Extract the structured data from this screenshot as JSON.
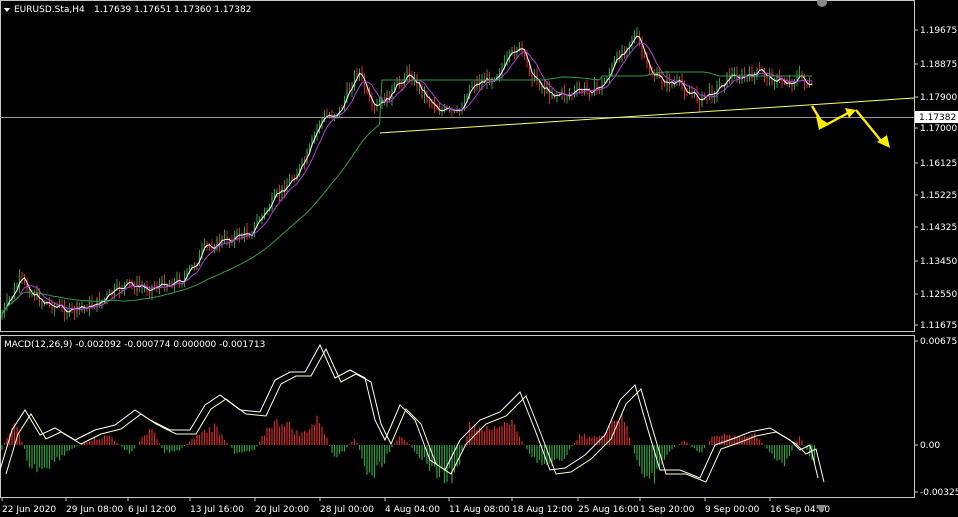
{
  "header": {
    "symbol": "EURUSD.Sta,H4",
    "ohlc": "1.17639 1.17651 1.17360 1.17382"
  },
  "macd_header": {
    "title": "MACD(12,26,9) -0.002092 -0.000774 0.000000 -0.001713"
  },
  "price_axis": {
    "labels": [
      "1.19675",
      "1.18875",
      "1.17900",
      "1.17000",
      "1.16125",
      "1.15225",
      "1.14325",
      "1.13450",
      "1.12550",
      "1.11675"
    ],
    "current_price": "1.17382"
  },
  "macd_axis": {
    "labels": [
      "0.006751",
      "0.00",
      "-0.003256"
    ]
  },
  "time_axis": {
    "labels": [
      "22 Jun 2020",
      "29 Jun 08:00",
      "6 Jul 12:00",
      "13 Jul 16:00",
      "20 Jul 20:00",
      "28 Jul 00:00",
      "4 Aug 04:00",
      "11 Aug 08:00",
      "18 Aug 12:00",
      "25 Aug 16:00",
      "1 Sep 20:00",
      "9 Sep 00:00",
      "16 Sep 04:00"
    ]
  },
  "colors": {
    "background": "#000000",
    "bull": "#2ea043",
    "bear": "#d42a2a",
    "ma_fast": "#ffffff",
    "ma_mid": "#b03cdc",
    "ma_slow": "#2ea043",
    "trendline": "#ffff66",
    "arrow": "#ffee00",
    "macd_signal": "#ffffcc"
  },
  "chart_data": {
    "type": "line",
    "symbol": "EURUSD.Sta",
    "timeframe": "H4",
    "x": [
      "22 Jun 2020",
      "29 Jun 08:00",
      "6 Jul 12:00",
      "13 Jul 16:00",
      "20 Jul 20:00",
      "28 Jul 00:00",
      "4 Aug 04:00",
      "11 Aug 08:00",
      "18 Aug 12:00",
      "25 Aug 16:00",
      "1 Sep 20:00",
      "9 Sep 00:00",
      "16 Sep 04:00"
    ],
    "series": [
      {
        "values": [
          1.123,
          1.125,
          1.13,
          1.14,
          1.155,
          1.187,
          1.182,
          1.18,
          1.188,
          1.183,
          1.196,
          1.183,
          1.18
        ]
      }
    ],
    "ylim": [
      1.11675,
      1.202
    ],
    "macd_ylim": [
      -0.003256,
      0.006751
    ]
  }
}
